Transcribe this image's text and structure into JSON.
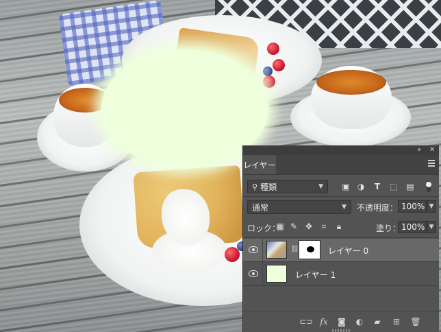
{
  "canvas": {
    "blob_color": "#eeffdc"
  },
  "panel": {
    "header_controls": {
      "collapse_icon": "double-chevron-right-icon",
      "close_icon": "close-icon"
    },
    "tab_label": "レイヤー",
    "filter": {
      "selected": "種類",
      "icon": "search-icon"
    },
    "filter_icons": [
      "image-filter-icon",
      "adjustment-filter-icon",
      "type-filter-icon",
      "shape-filter-icon",
      "smart-object-filter-icon"
    ],
    "blend_mode": "通常",
    "opacity_label": "不透明度：",
    "opacity_value": "100%",
    "lock_label": "ロック：",
    "lock_icons": [
      "lock-transparent-icon",
      "lock-image-icon",
      "lock-position-icon",
      "lock-artboard-icon",
      "lock-all-icon"
    ],
    "fill_label": "塗り：",
    "fill_value": "100%",
    "layers": [
      {
        "name": "レイヤー 0",
        "visible": true,
        "selected": true,
        "has_mask": true
      },
      {
        "name": "レイヤー 1",
        "visible": true,
        "selected": false,
        "has_mask": false,
        "fill_color": "#eeffdc"
      }
    ],
    "footer_icons": [
      "link-layers-icon",
      "fx-icon",
      "add-mask-icon",
      "adjustment-layer-icon",
      "new-group-icon",
      "new-layer-icon",
      "trash-icon"
    ],
    "footer_fx_text": "fx"
  }
}
